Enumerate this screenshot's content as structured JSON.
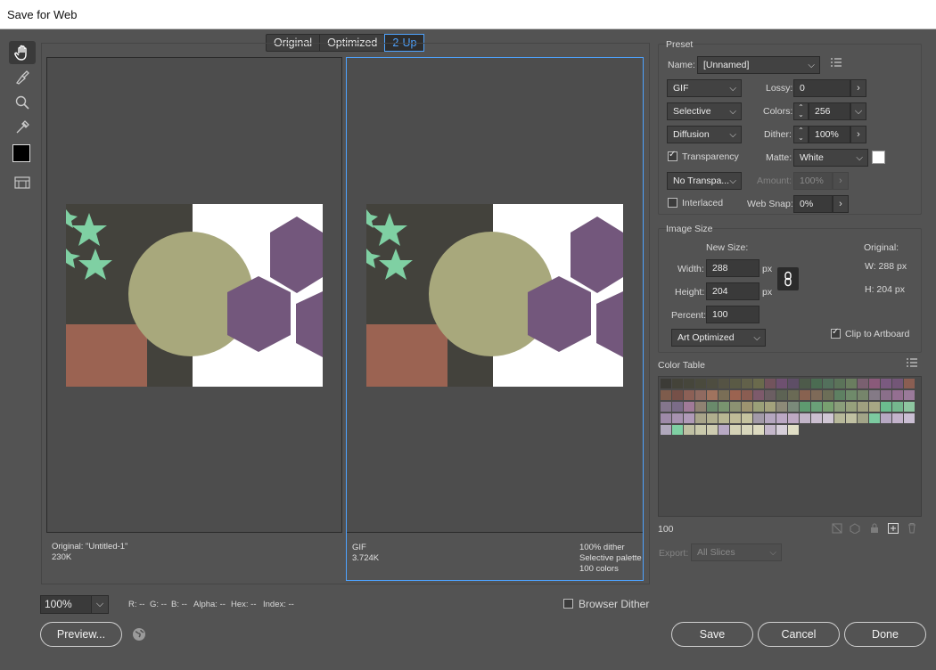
{
  "window": {
    "title": "Save for Web"
  },
  "tabs": [
    {
      "label": "Original"
    },
    {
      "label": "Optimized"
    },
    {
      "label": "2-Up"
    }
  ],
  "original_pane": {
    "name_line": "Original: \"Untitled-1\"",
    "size": "230K"
  },
  "optimized_pane": {
    "format": "GIF",
    "size": "3.724K",
    "dither": "100% dither",
    "palette": "Selective palette",
    "colors": "100 colors"
  },
  "preset": {
    "group_title": "Preset",
    "name_label": "Name:",
    "name_value": "[Unnamed]",
    "format": "GIF",
    "reduction": "Selective",
    "dither_algo": "Diffusion",
    "lossy_label": "Lossy:",
    "lossy_value": "0",
    "colors_label": "Colors:",
    "colors_value": "256",
    "dither_label": "Dither:",
    "dither_value": "100%",
    "transparency_label": "Transparency",
    "transparency_checked": true,
    "matte_label": "Matte:",
    "matte_value": "White",
    "trans_dither": "No Transpa...",
    "amount_label": "Amount:",
    "amount_value": "100%",
    "interlaced_label": "Interlaced",
    "interlaced_checked": false,
    "websnap_label": "Web Snap:",
    "websnap_value": "0%"
  },
  "image_size": {
    "group_title": "Image Size",
    "new_size_label": "New Size:",
    "original_label": "Original:",
    "width_label": "Width:",
    "width_value": "288",
    "width_unit": "px",
    "height_label": "Height:",
    "height_value": "204",
    "height_unit": "px",
    "percent_label": "Percent:",
    "percent_value": "100",
    "orig_w": "W:  288 px",
    "orig_h": "H:  204 px",
    "quality": "Art Optimized",
    "clip_label": "Clip to Artboard",
    "clip_checked": true
  },
  "color_table": {
    "title": "Color Table",
    "count": "100",
    "export_label": "Export:",
    "export_value": "All Slices",
    "colors": [
      "#3c3b36",
      "#444339",
      "#46463b",
      "#4a4a3d",
      "#4e4d40",
      "#555344",
      "#5a5a45",
      "#62614a",
      "#6a6a4c",
      "#72535c",
      "#6e5070",
      "#5e4e66",
      "#4d5a4a",
      "#4b6c52",
      "#53705c",
      "#5b7359",
      "#6a7d5f",
      "#7a6070",
      "#8a5a7a",
      "#7a5a80",
      "#735677",
      "#8a5e52",
      "#7e5c4c",
      "#765048",
      "#8c6056",
      "#906a60",
      "#a0735e",
      "#7a6e56",
      "#9b6350",
      "#8a5d52",
      "#7d5a6b",
      "#6b5e62",
      "#5d6354",
      "#6a6a55",
      "#886250",
      "#7e6a58",
      "#6c6e57",
      "#5e8062",
      "#6f8a6a",
      "#76856b",
      "#847a86",
      "#8a6f8a",
      "#946f91",
      "#9a7a9a",
      "#84768c",
      "#7b6c88",
      "#a07a98",
      "#8f8272",
      "#6a8a6b",
      "#79946f",
      "#8c9272",
      "#9d9470",
      "#9aa078",
      "#a3a27c",
      "#8d8a78",
      "#7a8a7a",
      "#5e9a70",
      "#6aa078",
      "#78a070",
      "#8a9d7a",
      "#96a07c",
      "#a0a080",
      "#a8a884",
      "#6bbc8e",
      "#75b88e",
      "#8ec6a0",
      "#9e8aa8",
      "#a792b0",
      "#b09ab8",
      "#a8a48a",
      "#b0ae8e",
      "#b8b693",
      "#c0bc98",
      "#c5c39f",
      "#a29aa8",
      "#b4a6be",
      "#bba8c4",
      "#bea9c3",
      "#c2b5c8",
      "#cbbfd0",
      "#d0c7d4",
      "#b7b89a",
      "#c0c0a2",
      "#a2a488",
      "#7ccaa0",
      "#b6a8c2",
      "#c3b3cb",
      "#cabed3",
      "#b0a8bc",
      "#7fd0a3",
      "#bfc0a3",
      "#c9c9ab",
      "#cdcbb0",
      "#b8a9c4",
      "#d4d2b6",
      "#d8d7bc",
      "#dcdac0",
      "#c4b7ca",
      "#d6cfd9",
      "#e0dec5",
      "#e4e3cc",
      "#e6e4d3",
      "#c8ccd1",
      "#d9d6c9",
      "#c6c2b0",
      "#cfc9c0",
      "#b1aed0",
      "#c6c0d6",
      "#c9c2a9",
      "#b8b5a1",
      "#e0dfd2",
      "#e6e5d8",
      "#ebeae0",
      "#efeee6",
      "#d8d6d4",
      "#e8e6e2",
      "#eeeeea",
      "#f2f2ee",
      "#f6f6f4",
      "#f8f8f6",
      "#fafaf9",
      "#ffffff"
    ]
  },
  "status": {
    "zoom": "100%",
    "r": "R: --",
    "g": "G: --",
    "b": "B: --",
    "alpha": "Alpha: --",
    "hex": "Hex: --",
    "index": "Index: --",
    "browser_dither": "Browser Dither"
  },
  "buttons": {
    "preview": "Preview...",
    "save": "Save",
    "cancel": "Cancel",
    "done": "Done"
  }
}
